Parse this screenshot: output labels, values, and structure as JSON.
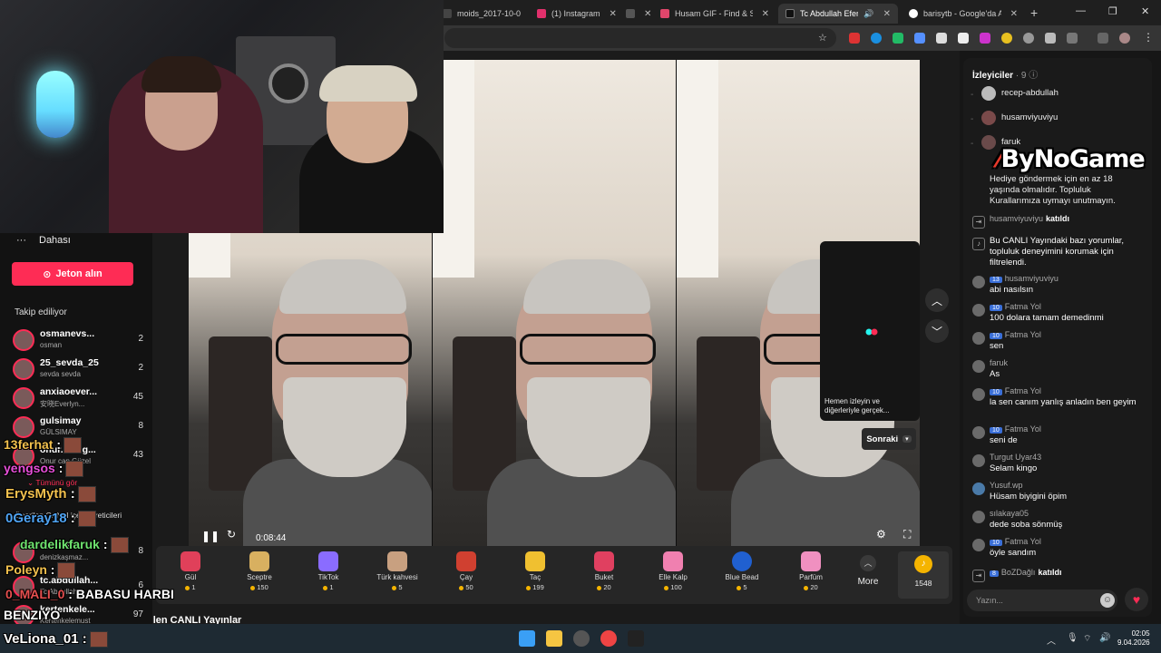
{
  "browser": {
    "tabs": [
      {
        "title": "moids_2017-10-0",
        "color": "#444",
        "active": false
      },
      {
        "title": "(1) Instagram",
        "color": "#e1306c",
        "active": false
      },
      {
        "title": "",
        "color": "#555",
        "active": false
      },
      {
        "title": "Husam GIF - Find & Share",
        "color": "#e0466b",
        "active": false
      },
      {
        "title": "Tc Abdullah Efendi (@",
        "color": "#111",
        "active": true
      },
      {
        "title": "barisytb - Google'da Ara",
        "color": "#ffffff",
        "active": false
      }
    ],
    "new_tab": "+",
    "win_minimize": "—",
    "win_restore": "❐",
    "win_close": "✕"
  },
  "sidebar": {
    "more_label": "Dahası",
    "coins_button": "Jeton alın",
    "following_title": "Takip ediliyor",
    "following": [
      {
        "name": "osmanevs...",
        "sub": "osman",
        "count": "2"
      },
      {
        "name": "25_sevda_25",
        "sub": "sevda sevda",
        "count": "2"
      },
      {
        "name": "anxiaoever...",
        "sub": "安晓Everlyn...",
        "count": "45"
      },
      {
        "name": "gulsimay",
        "sub": "GÜLSIMAY",
        "count": "8"
      },
      {
        "name": "onur.can.g...",
        "sub": "Onur can Güzel",
        "count": "43"
      },
      {
        "name": "nazli399d",
        "sub": "denizkaşmaz...",
        "count": "8"
      },
      {
        "name": "tc.abdullah...",
        "sub": "Tc Abdullah...",
        "count": "6"
      },
      {
        "name": "kertenkele...",
        "sub": "Kertenkelemust",
        "count": "97"
      }
    ],
    "see_all": "Tümünü gör",
    "creators_label": "Önerilen CANLI içerik üreticileri"
  },
  "stream_overlay": [
    {
      "user": "13ferhat",
      "msg": ":",
      "color": "#f2c14e"
    },
    {
      "user": "yengsos",
      "msg": ":",
      "color": "#e64fd8"
    },
    {
      "user": "ErysMyth",
      "msg": ":",
      "color": "#f2c14e"
    },
    {
      "user": "0Geray18",
      "msg": ":",
      "color": "#4fa3f2"
    },
    {
      "user": "dardelikfaruk",
      "msg": ":",
      "color": "#6fe36f"
    },
    {
      "user": "Poleyn",
      "msg": ":",
      "color": "#f2c14e"
    },
    {
      "user": "0_MALI_0",
      "msg": ": BABASU HARBI",
      "color": "#e64f4f"
    },
    {
      "user": "BENZIYO",
      "msg": "",
      "color": "#ffffff"
    },
    {
      "user": "VeLiona_01",
      "msg": ":",
      "color": "#ffffff"
    }
  ],
  "player": {
    "time": "0:08:44",
    "next_caption": "Hemen izleyin ve diğerleriyle gerçek...",
    "next_button": "Sonraki",
    "pause_icon": "pause-icon",
    "up_arrow": "⌃",
    "down_arrow": "⌄"
  },
  "gifts": [
    {
      "name": "Gül",
      "price": "1",
      "color": "#e0405a"
    },
    {
      "name": "Sceptre",
      "price": "150",
      "color": "#d8b060"
    },
    {
      "name": "TikTok",
      "price": "1",
      "color": "#8a6cff"
    },
    {
      "name": "Türk kahvesi",
      "price": "5",
      "color": "#c8a080"
    },
    {
      "name": "Çay",
      "price": "50",
      "color": "#d04030"
    },
    {
      "name": "Taç",
      "price": "199",
      "color": "#f0c030"
    },
    {
      "name": "Buket",
      "price": "20",
      "color": "#e04060"
    },
    {
      "name": "Elle Kalp",
      "price": "100",
      "color": "#f080b0"
    },
    {
      "name": "Blue Bead",
      "price": "5",
      "color": "#2060d0"
    },
    {
      "name": "Parfüm",
      "price": "20",
      "color": "#f090c0"
    }
  ],
  "gift_more": "Daha fazla",
  "gift_more_label": "More",
  "balance": "1548",
  "suggested_title": "Önerilen CANLI Yayınlar",
  "right_panel": {
    "viewers_title": "İzleyiciler",
    "viewers_count": "· 9",
    "viewers": [
      "recep-abdullah",
      "husamviyuviyu",
      "faruk"
    ],
    "logo_text": "ByNoGame",
    "notice": "Hediye göndermek için en az 18 yaşında olmalıdır. Topluluk Kurallarımıza uymayı unutmayın.",
    "filter_notice": "Bu CANLI Yayındaki bazı yorumlar, topluluk deneyimini korumak için filtrelendi.",
    "messages": [
      {
        "user": "husamviyuviyu",
        "badge": "",
        "text": "",
        "joined": "katıldı",
        "kind": "join"
      },
      {
        "user": "husamviyuviyu",
        "badge": "13",
        "text": "abi nasılsın",
        "joined": "",
        "kind": "msg"
      },
      {
        "user": "Fatma Yol",
        "badge": "10",
        "text": "100 dolara tamam demedinmi",
        "joined": "",
        "kind": "msg"
      },
      {
        "user": "Fatma Yol",
        "badge": "10",
        "text": "sen",
        "joined": "",
        "kind": "msg"
      },
      {
        "user": "faruk",
        "badge": "",
        "text": "As",
        "joined": "",
        "kind": "msg"
      },
      {
        "user": "Fatma Yol",
        "badge": "10",
        "text": "la sen canım yanlış anladın ben geyim",
        "joined": "",
        "kind": "msg"
      },
      {
        "user": "Fatma Yol",
        "badge": "10",
        "text": "seni de",
        "joined": "",
        "kind": "msg"
      },
      {
        "user": "Turgut Uyar43",
        "badge": "",
        "text": "Selam kingo",
        "joined": "",
        "kind": "msg"
      },
      {
        "user": "Yusuf.wp",
        "badge": "",
        "text": "Hüsam biyigini öpim",
        "joined": "",
        "kind": "msg"
      },
      {
        "user": "sılakaya05",
        "badge": "",
        "text": "dede soba sönmüş",
        "joined": "",
        "kind": "msg"
      },
      {
        "user": "Fatma Yol",
        "badge": "10",
        "text": "öyle sandım",
        "joined": "",
        "kind": "msg"
      },
      {
        "user": "BoZDağlı",
        "badge": "8",
        "text": "",
        "joined": "katıldı",
        "kind": "join"
      }
    ],
    "input_placeholder": "Yazın..."
  },
  "taskbar": {
    "time": "02:05",
    "date": "9.04.2026"
  }
}
